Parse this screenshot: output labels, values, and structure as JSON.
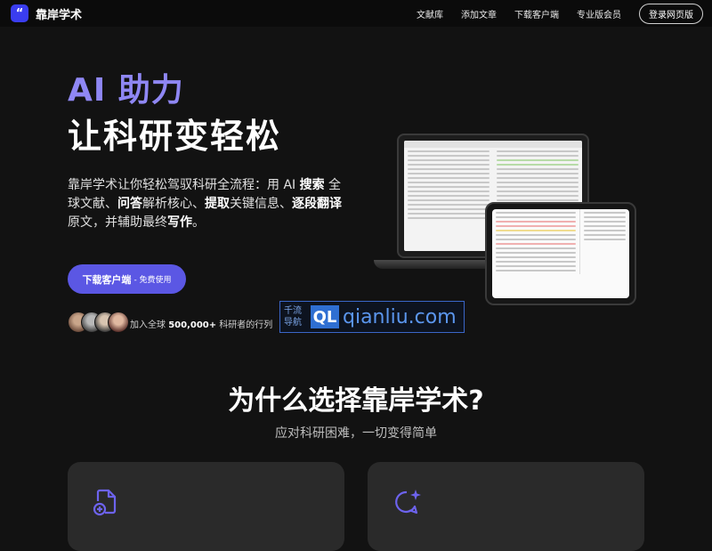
{
  "header": {
    "logo_mark": "“",
    "brand": "靠岸学术",
    "nav": [
      "文献库",
      "添加文章",
      "下载客户端",
      "专业版会员"
    ],
    "login_label": "登录网页版"
  },
  "hero": {
    "accent": "AI 助力",
    "title": "让科研变轻松",
    "desc_parts": [
      "靠岸学术让你轻松驾驭科研全流程：用 AI ",
      "搜索",
      " 全球文献、",
      "问答",
      "解析核心、",
      "提取",
      "关键信息、",
      "逐段翻译",
      "原文，并辅助最终",
      "写作",
      "。"
    ],
    "cta_label": "下载客户端",
    "cta_sub": "- 免费使用",
    "users_prefix": "加入全球 ",
    "users_count": "500,000+",
    "users_suffix": " 科研者的行列"
  },
  "watermark": {
    "left_text": "千流导航",
    "ql": "QL",
    "domain": "qianliu.com"
  },
  "why": {
    "title": "为什么选择靠岸学术?",
    "subtitle": "应对科研困难，一切变得简单"
  },
  "cards": [
    {
      "icon": "document-add-icon"
    },
    {
      "icon": "chat-sparkle-icon"
    }
  ],
  "colors": {
    "accent": "#8f87f4",
    "cta": "#5b57e4",
    "brand_blue": "#3a3df0",
    "card_bg": "#2a2a2a",
    "icon": "#6d63ee"
  }
}
